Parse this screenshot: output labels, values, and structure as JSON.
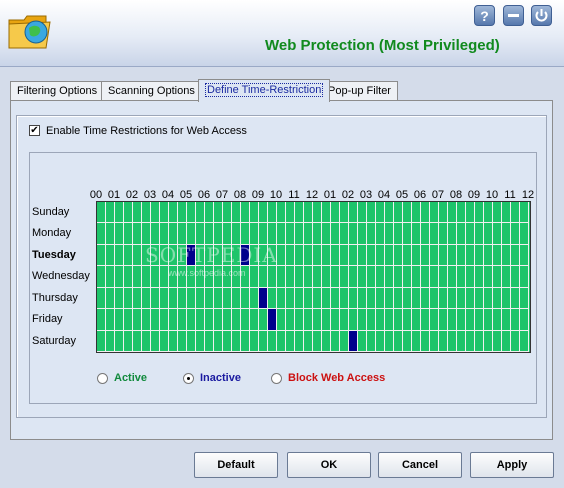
{
  "header": {
    "title": "Web Protection (Most Privileged)",
    "logo_icon": "folder-globe-icon",
    "help_icon": "help-icon",
    "minimize_icon": "minimize-icon",
    "power_icon": "power-icon",
    "help_label": "?"
  },
  "tabs": [
    {
      "label": "Filtering Options",
      "active": false
    },
    {
      "label": "Scanning Options",
      "active": false
    },
    {
      "label": "Define Time-Restriction",
      "active": true
    },
    {
      "label": "Pop-up Filter",
      "active": false
    }
  ],
  "restriction": {
    "enable_label": "Enable Time Restrictions for Web Access",
    "enabled": true,
    "check_mark": "✔"
  },
  "schedule": {
    "hours": [
      "00",
      "01",
      "02",
      "03",
      "04",
      "05",
      "06",
      "07",
      "08",
      "09",
      "10",
      "11",
      "12",
      "01",
      "02",
      "03",
      "04",
      "05",
      "06",
      "07",
      "08",
      "09",
      "10",
      "11",
      "12"
    ],
    "days": [
      {
        "label": "Sunday",
        "bold": false
      },
      {
        "label": "Monday",
        "bold": false
      },
      {
        "label": "Tuesday",
        "bold": true
      },
      {
        "label": "Wednesday",
        "bold": false
      },
      {
        "label": "Thursday",
        "bold": false
      },
      {
        "label": "Friday",
        "bold": false
      },
      {
        "label": "Saturday",
        "bold": false
      }
    ],
    "inactive_slots": [
      {
        "day": 2,
        "slot": 10
      },
      {
        "day": 2,
        "slot": 16
      },
      {
        "day": 4,
        "slot": 18
      },
      {
        "day": 5,
        "slot": 19
      },
      {
        "day": 6,
        "slot": 28
      }
    ],
    "colors": {
      "active": "#1ec46a",
      "inactive": "#00008c",
      "block": "#cc1111"
    }
  },
  "legend": {
    "active_label": "Active",
    "inactive_label": "Inactive",
    "block_label": "Block Web Access",
    "selected": "inactive",
    "active_color": "#118a3c",
    "inactive_color": "#1a1aa0",
    "block_color": "#cc1111"
  },
  "watermark": {
    "text": "SOFTPEDIA",
    "sub": "www.softpedia.com"
  },
  "buttons": {
    "default_label": "Default",
    "ok_label": "OK",
    "cancel_label": "Cancel",
    "apply_label": "Apply"
  }
}
